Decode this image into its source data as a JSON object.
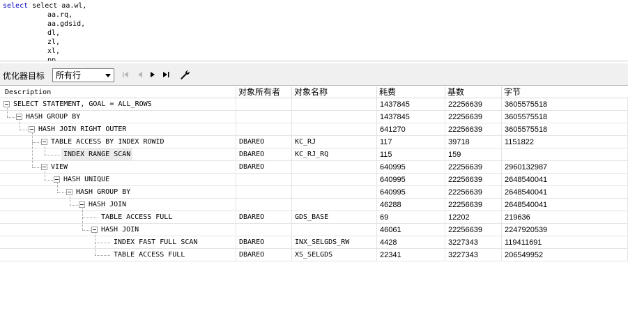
{
  "editor": {
    "lines": [
      "select aa.wl,",
      "aa.rq,",
      "aa.gdsid,",
      "dl,",
      "zl,",
      "xl,",
      "pp,"
    ]
  },
  "toolbar": {
    "optimizer_label": "优化器目标",
    "optimizer_value": "所有行"
  },
  "grid": {
    "columns": [
      "Description",
      "对象所有者",
      "对象名称",
      "耗费",
      "基数",
      "字节"
    ],
    "rows": [
      {
        "depth": 0,
        "desc": "SELECT STATEMENT, GOAL = ALL_ROWS",
        "owner": "",
        "name": "",
        "cost": "1437845",
        "card": "22256639",
        "bytes": "3605575518",
        "expandable": true,
        "selected": false
      },
      {
        "depth": 1,
        "desc": "HASH GROUP BY",
        "owner": "",
        "name": "",
        "cost": "1437845",
        "card": "22256639",
        "bytes": "3605575518",
        "expandable": true,
        "selected": false
      },
      {
        "depth": 2,
        "desc": "HASH JOIN RIGHT OUTER",
        "owner": "",
        "name": "",
        "cost": "641270",
        "card": "22256639",
        "bytes": "3605575518",
        "expandable": true,
        "selected": false
      },
      {
        "depth": 3,
        "desc": "TABLE ACCESS BY INDEX ROWID",
        "owner": "DBAREO",
        "name": "KC_RJ",
        "cost": "117",
        "card": "39718",
        "bytes": "1151822",
        "expandable": true,
        "selected": false
      },
      {
        "depth": 4,
        "desc": "INDEX RANGE SCAN",
        "owner": "DBAREO",
        "name": "KC_RJ_RQ",
        "cost": "115",
        "card": "159",
        "bytes": "",
        "expandable": false,
        "selected": true
      },
      {
        "depth": 3,
        "desc": "VIEW",
        "owner": "DBAREO",
        "name": "",
        "cost": "640995",
        "card": "22256639",
        "bytes": "2960132987",
        "expandable": true,
        "selected": false
      },
      {
        "depth": 4,
        "desc": "HASH UNIQUE",
        "owner": "",
        "name": "",
        "cost": "640995",
        "card": "22256639",
        "bytes": "2648540041",
        "expandable": true,
        "selected": false
      },
      {
        "depth": 5,
        "desc": "HASH GROUP BY",
        "owner": "",
        "name": "",
        "cost": "640995",
        "card": "22256639",
        "bytes": "2648540041",
        "expandable": true,
        "selected": false
      },
      {
        "depth": 6,
        "desc": "HASH JOIN",
        "owner": "",
        "name": "",
        "cost": "46288",
        "card": "22256639",
        "bytes": "2648540041",
        "expandable": true,
        "selected": false
      },
      {
        "depth": 7,
        "desc": "TABLE ACCESS FULL",
        "owner": "DBAREO",
        "name": "GDS_BASE",
        "cost": "69",
        "card": "12202",
        "bytes": "219636",
        "expandable": false,
        "selected": false
      },
      {
        "depth": 7,
        "desc": "HASH JOIN",
        "owner": "",
        "name": "",
        "cost": "46061",
        "card": "22256639",
        "bytes": "2247920539",
        "expandable": true,
        "selected": false
      },
      {
        "depth": 8,
        "desc": "INDEX FAST FULL SCAN",
        "owner": "DBAREO",
        "name": "INX_SELGDS_RW",
        "cost": "4428",
        "card": "3227343",
        "bytes": "119411691",
        "expandable": false,
        "selected": false
      },
      {
        "depth": 8,
        "desc": "TABLE ACCESS FULL",
        "owner": "DBAREO",
        "name": "XS_SELGDS",
        "cost": "22341",
        "card": "3227343",
        "bytes": "206549952",
        "expandable": false,
        "selected": false
      }
    ]
  }
}
